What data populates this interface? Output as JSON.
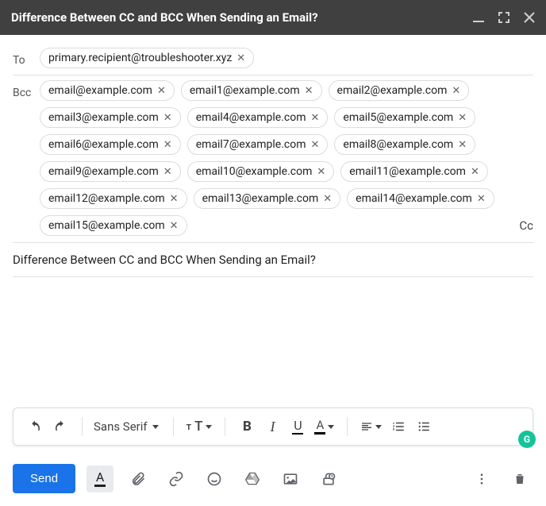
{
  "header": {
    "title": "Difference Between CC and BCC When Sending an Email?"
  },
  "to_label": "To",
  "bcc_label": "Bcc",
  "cc_button": "Cc",
  "to_chips": [
    "primary.recipient@troubleshooter.xyz"
  ],
  "bcc_chips": [
    "email@example.com",
    "email1@example.com",
    "email2@example.com",
    "email3@example.com",
    "email4@example.com",
    "email5@example.com",
    "email6@example.com",
    "email7@example.com",
    "email8@example.com",
    "email9@example.com",
    "email10@example.com",
    "email11@example.com",
    "email12@example.com",
    "email13@example.com",
    "email14@example.com",
    "email15@example.com"
  ],
  "subject": "Difference Between CC and BCC When Sending an Email?",
  "font": "Sans Serif",
  "send": "Send"
}
